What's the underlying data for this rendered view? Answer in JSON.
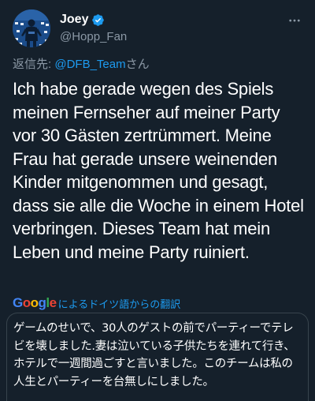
{
  "user": {
    "display_name": "Joey",
    "handle": "@Hopp_Fan",
    "verified": true,
    "verified_color": "#1d9bf0"
  },
  "reply": {
    "prefix": "返信先: ",
    "mention": "@DFB_Team",
    "suffix": "さん"
  },
  "tweet": {
    "text": "Ich habe gerade wegen des Spiels meinen Fernseher auf meiner Party vor 30 Gästen zertrümmert. Meine Frau hat gerade unsere weinenden Kinder mitgenommen und gesagt, dass sie alle die Woche in einem Hotel verbringen. Dieses Team hat mein Leben und meine Party ruiniert."
  },
  "translate": {
    "provider": "Google",
    "label": "によるドイツ語からの翻訳",
    "link_color": "#1d9bf0"
  },
  "translation": {
    "text": "ゲームのせいで、30人のゲストの前でパーティーでテレビを壊しました.妻は泣いている子供たちを連れて行き、ホテルで一週間過ごすと言いました。このチームは私の人生とパーティーを台無しにしました。"
  },
  "icons": {
    "more": "more-horizontal-icon",
    "verified": "verified-badge-icon",
    "avatar": "avatar"
  },
  "colors": {
    "background": "#15202b",
    "secondary_text": "#8b98a5",
    "accent": "#1d9bf0"
  }
}
